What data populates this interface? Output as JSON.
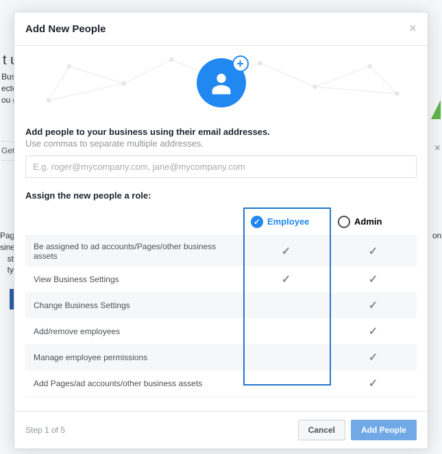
{
  "modal": {
    "title": "Add New People",
    "instruction": "Add people to your business using their email addresses.",
    "instruction_sub": "Use commas to separate multiple addresses.",
    "email_placeholder": "E.g. roger@mycompany.com, jane@mycompany.com",
    "assign_label": "Assign the new people a role:"
  },
  "roles": {
    "employee": "Employee",
    "admin": "Admin"
  },
  "permissions": {
    "p0": "Be assigned to ad accounts/Pages/other business assets",
    "p1": "View Business Settings",
    "p2": "Change Business Settings",
    "p3": "Add/remove employees",
    "p4": "Manage employee permissions",
    "p5": "Add Pages/ad accounts/other business assets"
  },
  "footer": {
    "step": "Step 1 of 5",
    "cancel": "Cancel",
    "add": "Add People"
  }
}
